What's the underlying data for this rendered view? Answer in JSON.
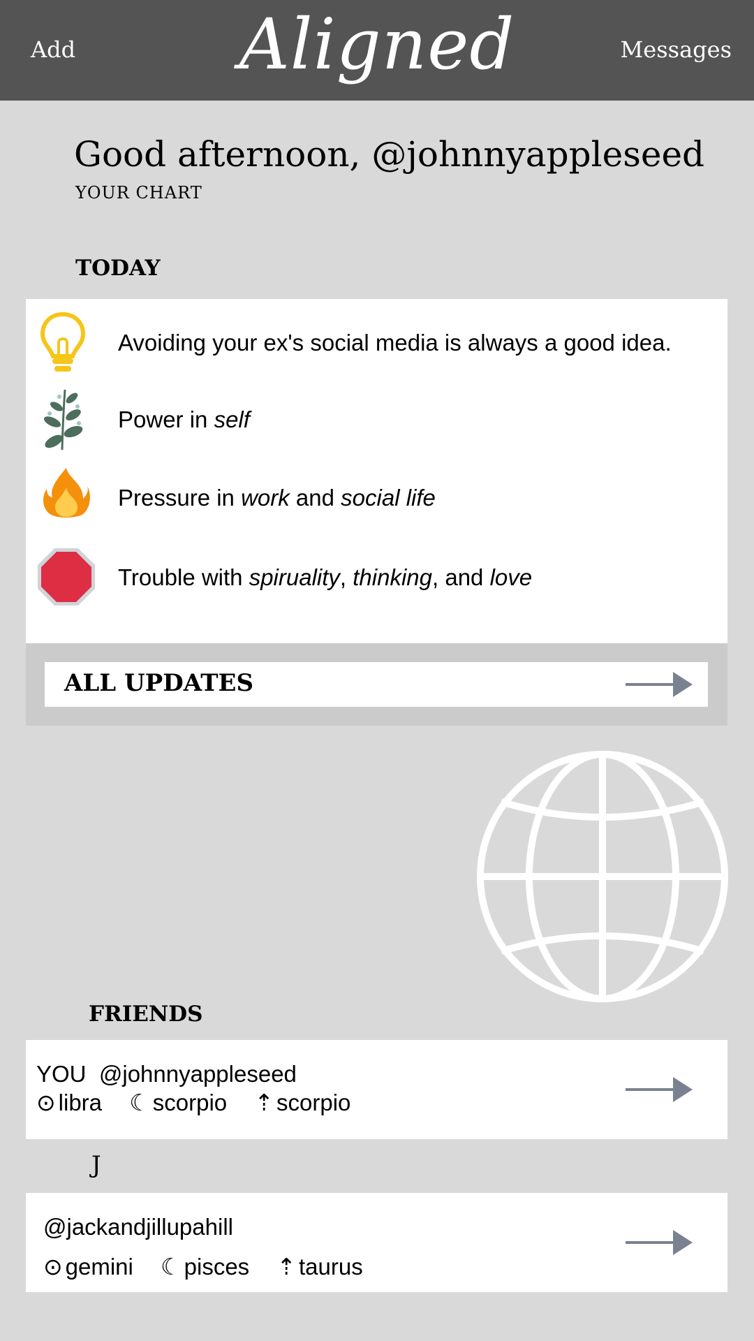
{
  "header": {
    "add_label": "Add",
    "logo": "Aligned",
    "messages_label": "Messages"
  },
  "greeting": "Good afternoon, @johnnyappleseed",
  "your_chart_label": "YOUR CHART",
  "today": {
    "heading": "TODAY",
    "items": [
      {
        "icon": "lightbulb-icon",
        "parts": [
          {
            "t": "Avoiding your ex's social media is always a good idea.",
            "i": false
          }
        ]
      },
      {
        "icon": "sprout-icon",
        "parts": [
          {
            "t": "Power in ",
            "i": false
          },
          {
            "t": "self",
            "i": true
          }
        ]
      },
      {
        "icon": "fire-icon",
        "parts": [
          {
            "t": "Pressure in ",
            "i": false
          },
          {
            "t": "work",
            "i": true
          },
          {
            "t": " and ",
            "i": false
          },
          {
            "t": "social life",
            "i": true
          }
        ]
      },
      {
        "icon": "stop-sign-icon",
        "parts": [
          {
            "t": "Trouble with ",
            "i": false
          },
          {
            "t": "spiruality",
            "i": true
          },
          {
            "t": ", ",
            "i": false
          },
          {
            "t": "thinking",
            "i": true
          },
          {
            "t": ", and ",
            "i": false
          },
          {
            "t": "love",
            "i": true
          }
        ]
      }
    ]
  },
  "all_updates_label": "ALL UPDATES",
  "friends": {
    "heading": "FRIENDS",
    "you": {
      "prefix": "YOU",
      "handle": "@johnnyappleseed",
      "signs": [
        {
          "symbol": "⊙",
          "name": "libra"
        },
        {
          "symbol": "☾",
          "name": "scorpio"
        },
        {
          "symbol": "⇡",
          "name": "scorpio"
        }
      ]
    },
    "group_letter": "J",
    "friend": {
      "handle": "@jackandjillupahill",
      "signs": [
        {
          "symbol": "⊙",
          "name": "gemini"
        },
        {
          "symbol": "☾",
          "name": "pisces"
        },
        {
          "symbol": "⇡",
          "name": "taurus"
        }
      ]
    }
  },
  "colors": {
    "header_bg": "#545454",
    "page_bg": "#d9d9d9",
    "arrow": "#7a8291",
    "bulb": "#f5c518",
    "stop": "#dd2e44"
  }
}
